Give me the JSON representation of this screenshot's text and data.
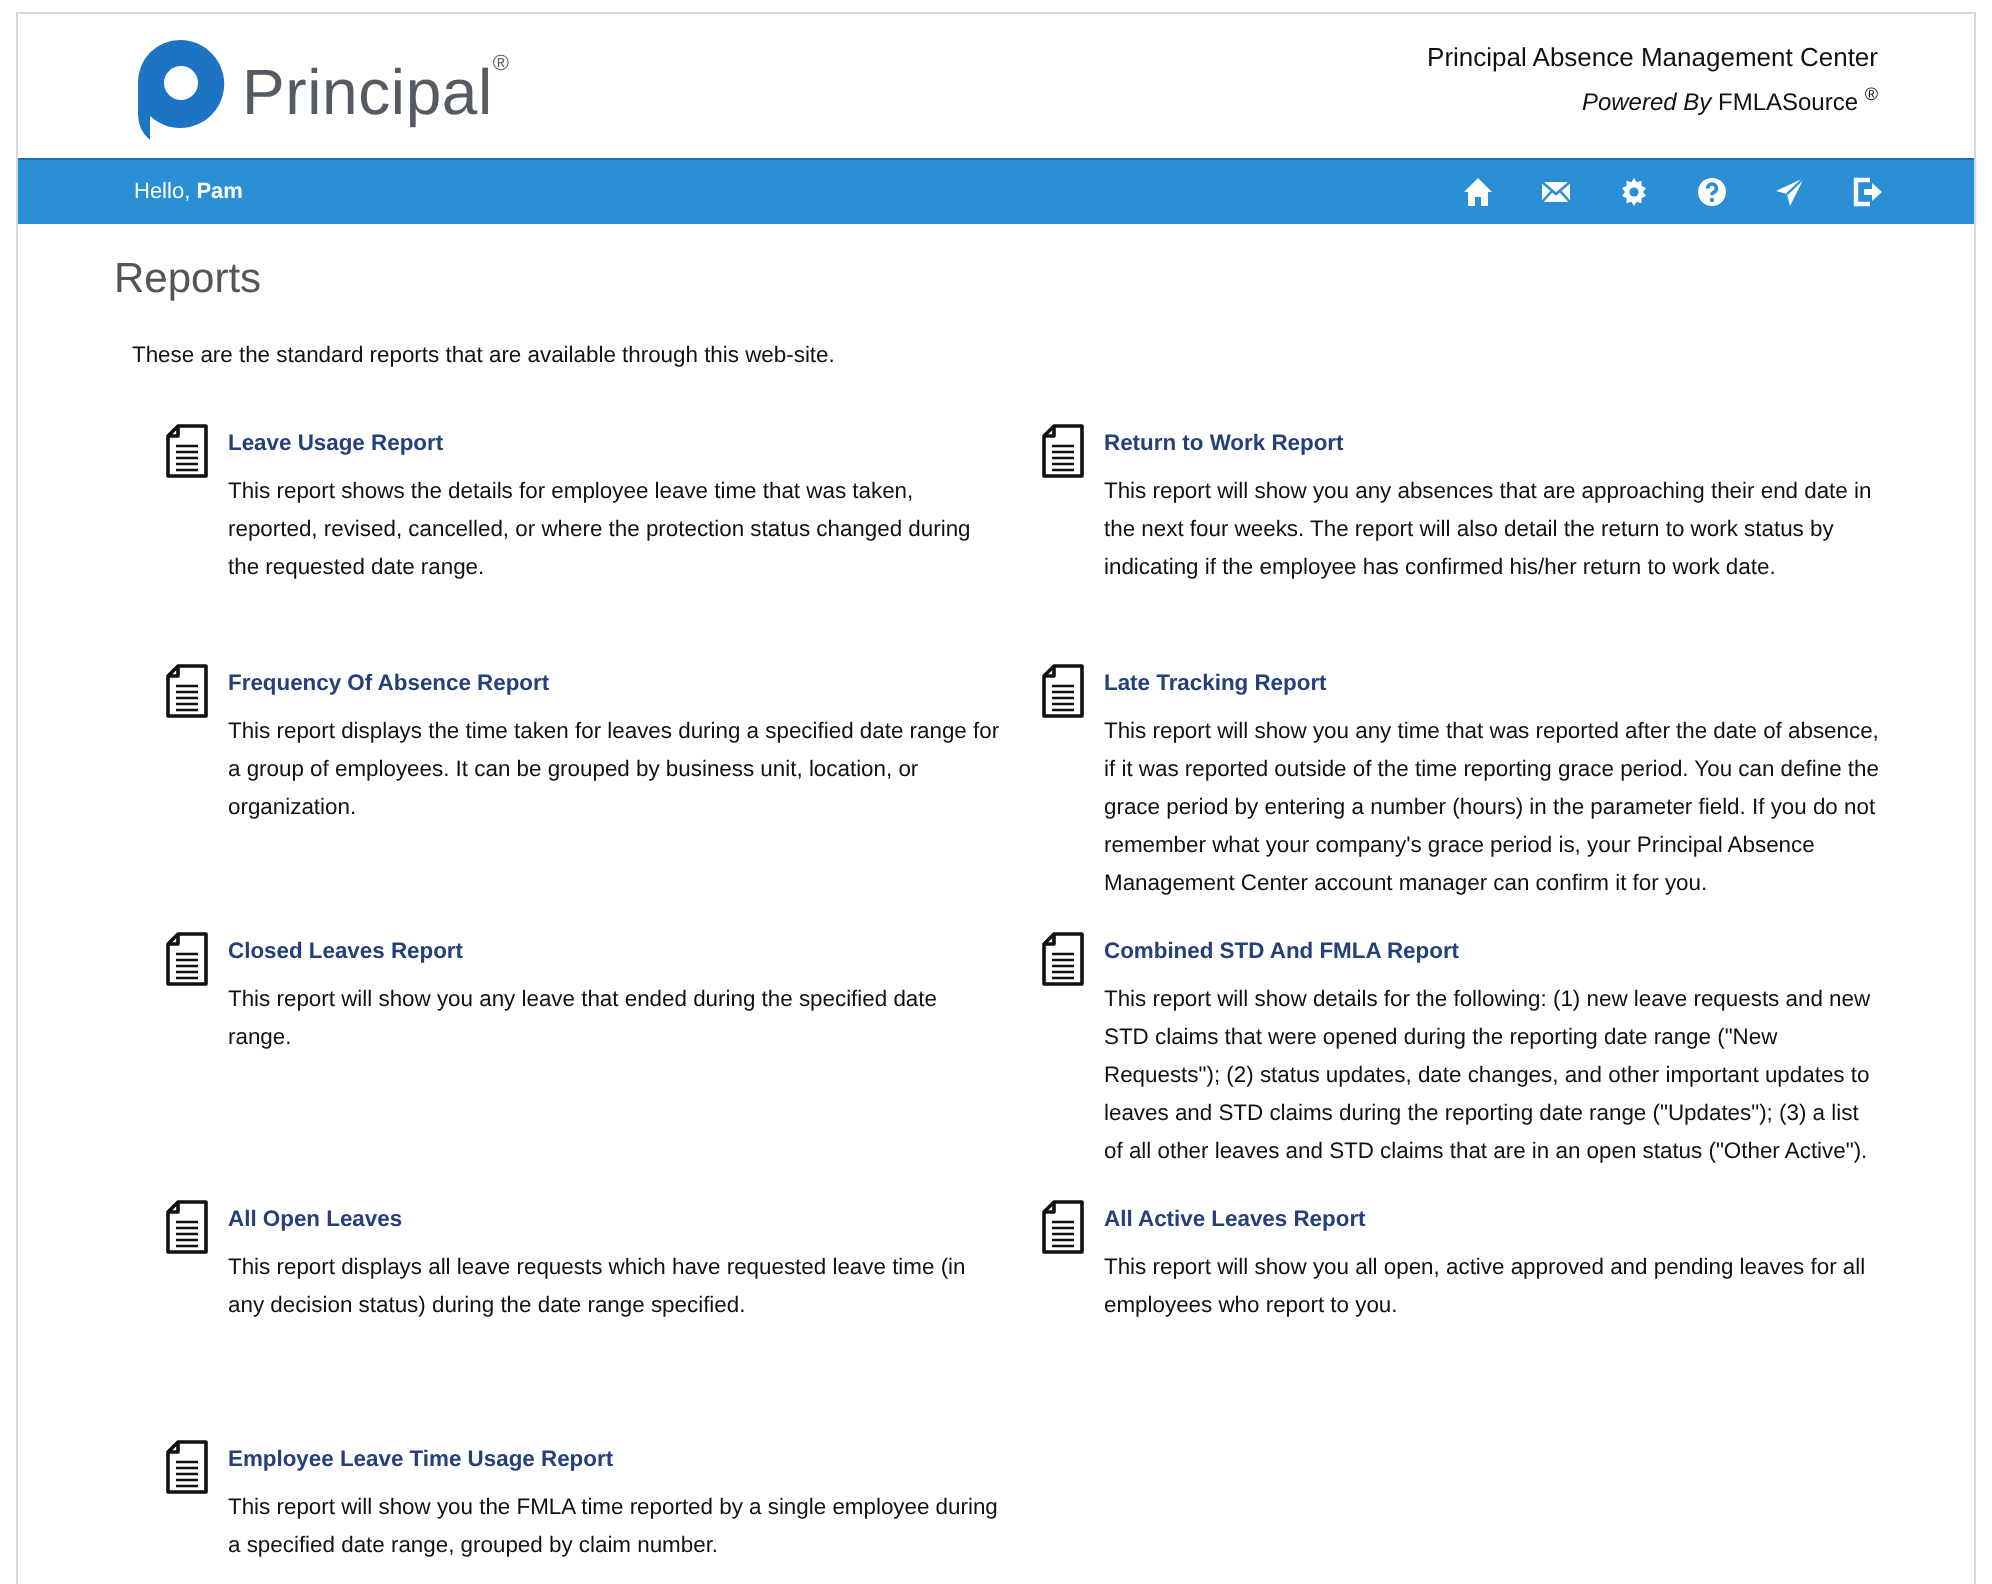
{
  "header": {
    "logo_text": "Principal$^{®}$",
    "app_title": "Principal Absence Management Center",
    "powered_by": "*Powered By* FMLASource $^{®}$"
  },
  "nav_bar": {
    "greeting": "Hello, **Pam**",
    "icons": [
      {
        "kind": "home"
      },
      {
        "kind": "mail"
      },
      {
        "kind": "settings"
      },
      {
        "kind": "help"
      },
      {
        "kind": "send"
      },
      {
        "kind": "logout"
      }
    ]
  },
  "page_title": "Reports",
  "intro": "These are the standard reports that are available through this web-site.",
  "reports": [
    {
      "title": "Leave Usage Report",
      "description": "This report shows the details for employee leave time that was taken, reported, revised, cancelled, or where the protection status changed during the requested date range."
    },
    {
      "title": "Return to Work Report",
      "description": "This report will show you any absences that are approaching their end date in the next four weeks. The report will also detail the return to work status by indicating if the employee has confirmed his/her return to work date."
    },
    {
      "title": "Frequency Of Absence Report",
      "description": "This report displays the time taken for leaves during a specified date range for a group of employees. It can be grouped by business unit, location, or organization."
    },
    {
      "title": "Late Tracking Report",
      "description": "This report will show you any time that was reported after the date of absence, if it was reported outside of the time reporting grace period. You can define the grace period by entering a number (hours) in the parameter field. If you do not remember what your company's grace period is, your Principal Absence Management Center account manager can confirm it for you."
    },
    {
      "title": "Closed Leaves Report",
      "description": "This report will show you any leave that ended during the specified date range."
    },
    {
      "title": "Combined STD And FMLA Report",
      "description": "This report will show details for the following: (1) new leave requests and new STD claims that were opened during the reporting date range (\"New Requests\"); (2) status updates, date changes, and other important updates to leaves and STD claims during the reporting date range (\"Updates\"); (3) a list of all other leaves and STD claims that are in an open status (\"Other Active\")."
    },
    {
      "title": "All Open Leaves",
      "description": "This report displays all leave requests which have requested leave time (in any decision status) during the date range specified."
    },
    {
      "title": "All Active Leaves Report",
      "description": "This report will show you all open, active approved and pending leaves for all employees who report to you."
    },
    {
      "title": "Employee Leave Time Usage Report",
      "description": "This report will show you the FMLA time reported by a single employee during a specified date range, grouped by claim number."
    }
  ]
}
